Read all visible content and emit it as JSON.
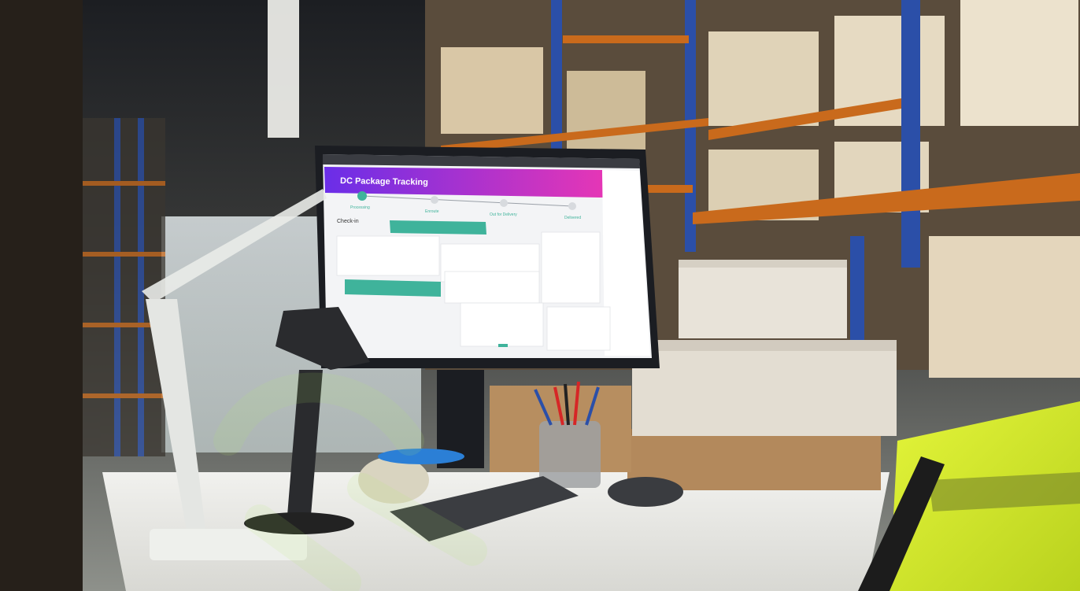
{
  "scene": {
    "description_hidden": "",
    "colors": {
      "floor": "#9b9d98",
      "desk": "#e6e6e2",
      "shelf_orange": "#c96a1c",
      "shelf_blue": "#2b4fa8",
      "box_light": "#e3ddd2",
      "box_kraft": "#b3895c",
      "vest_yellow": "#d6ef2a",
      "monitor_frame": "#1b1d22",
      "header_gradient_start": "#6a2ee8",
      "header_gradient_end": "#e536b6",
      "accent_teal": "#3fb39b"
    }
  },
  "monitor_app": {
    "title": "DC Package Tracking",
    "steps": [
      "Processing",
      "Enroute",
      "Out for Delivery",
      "Delivered"
    ],
    "section_title": "Check-in"
  }
}
